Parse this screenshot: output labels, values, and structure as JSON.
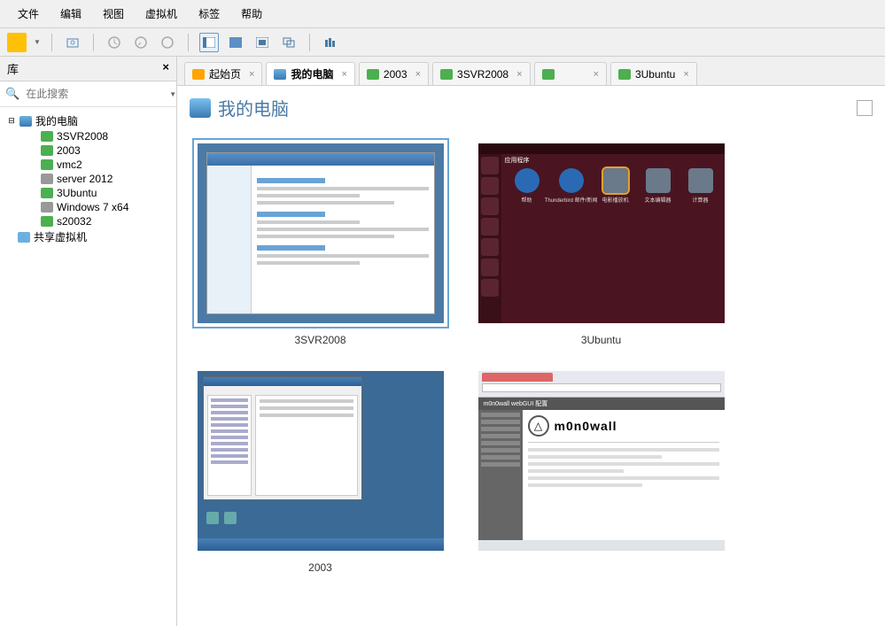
{
  "menu": {
    "file": "文件",
    "edit": "编辑",
    "view": "视图",
    "vm": "虚拟机",
    "tabs": "标签",
    "help": "帮助"
  },
  "sidebar": {
    "title": "库",
    "search_placeholder": "在此搜索",
    "root": "我的电脑",
    "shared": "共享虚拟机",
    "vms": [
      {
        "label": "3SVR2008"
      },
      {
        "label": "2003"
      },
      {
        "label": "vmc2"
      },
      {
        "label": "server 2012"
      },
      {
        "label": "3Ubuntu"
      },
      {
        "label": "Windows 7 x64"
      },
      {
        "label": "s20032"
      }
    ]
  },
  "tabs": {
    "home": "起始页",
    "mypc": "我的电脑",
    "t2003": "2003",
    "t3svr": "3SVR2008",
    "tblank": " ",
    "t3ubuntu": "3Ubuntu"
  },
  "page": {
    "title": "我的电脑"
  },
  "cards": {
    "c1": "3SVR2008",
    "c2": "3Ubuntu",
    "c3": "2003",
    "c4": ""
  },
  "ubuntu_thumb": {
    "apps_label": "应用程序",
    "a1": "帮助",
    "a2": "Thunderbird 邮件/新闻",
    "a3": "电影播放机",
    "a4": "文本编辑器",
    "a5": "计算器"
  },
  "mono_thumb": {
    "header": "m0n0wall  webGUI 配置",
    "logo": "m0n0wall"
  }
}
